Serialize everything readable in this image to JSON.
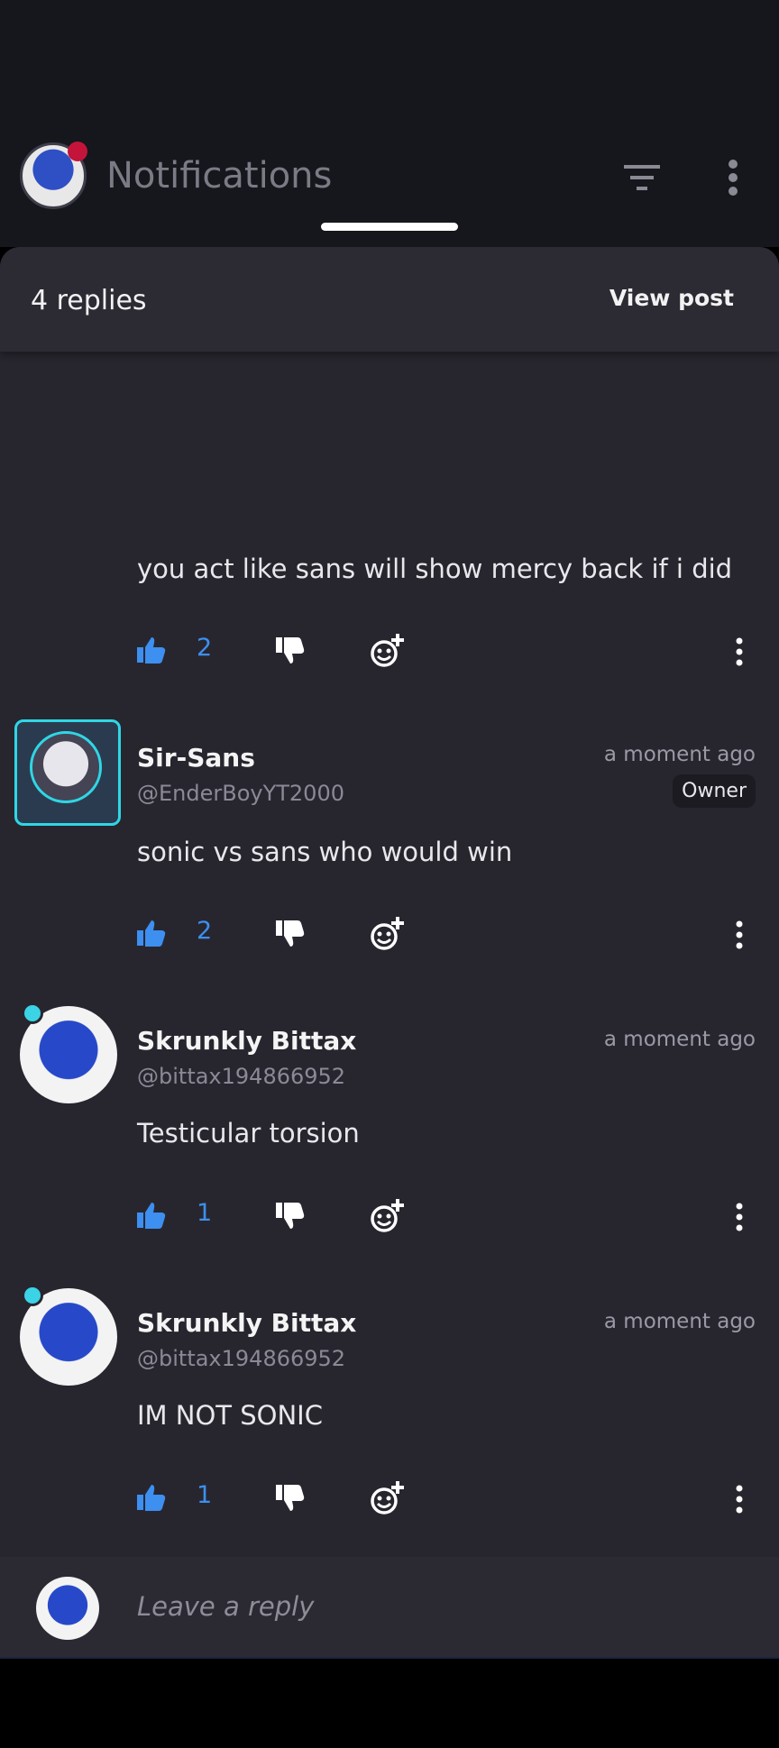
{
  "top_bar": {
    "title": "Notifications"
  },
  "sheet": {
    "replies_count": "4 replies",
    "view_post_label": "View post"
  },
  "comments": [
    {
      "text": "you act like sans will show mercy back if i did",
      "likes": "2"
    },
    {
      "author": "Sir-Sans",
      "handle": "@EnderBoyYT2000",
      "time": "a moment ago",
      "badge": "Owner",
      "text": "sonic vs sans who would win",
      "likes": "2"
    },
    {
      "author": "Skrunkly Bittax",
      "handle": "@bittax194866952",
      "time": "a moment ago",
      "text": "Testicular torsion",
      "likes": "1"
    },
    {
      "author": "Skrunkly Bittax",
      "handle": "@bittax194866952",
      "time": "a moment ago",
      "text": "IM NOT SONIC",
      "likes": "1"
    }
  ],
  "reply_bar": {
    "placeholder": "Leave a reply"
  },
  "colors": {
    "accent": "#3d8ff0",
    "sheet_bg": "#27262f",
    "top_bg": "#16161d"
  },
  "icons": [
    "filter-icon",
    "kebab-menu-icon",
    "thumbs-up-icon",
    "thumbs-down-icon",
    "add-reaction-icon",
    "more-options-icon"
  ]
}
